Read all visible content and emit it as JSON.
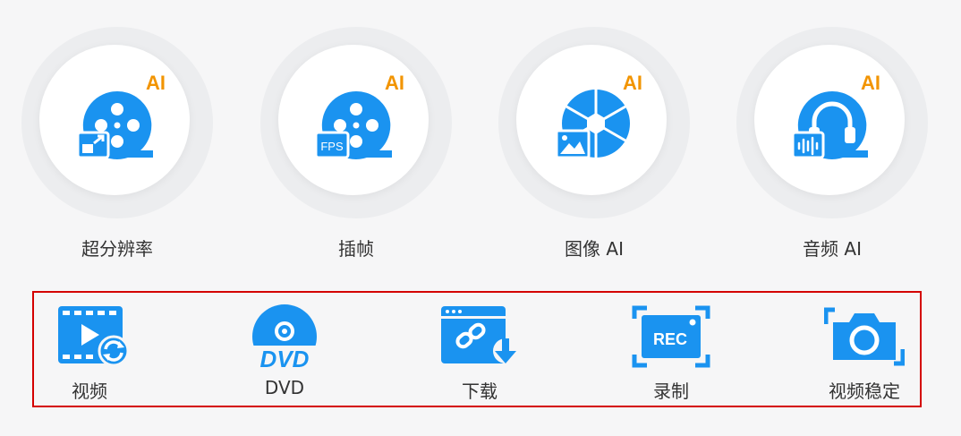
{
  "ai_tools": [
    {
      "label": "超分辨率",
      "badge": "AI",
      "icon": "film-reel-upscale-icon"
    },
    {
      "label": "插帧",
      "badge": "AI",
      "icon": "film-reel-fps-icon"
    },
    {
      "label": "图像 AI",
      "badge": "AI",
      "icon": "camera-aperture-image-icon"
    },
    {
      "label": "音频 AI",
      "badge": "AI",
      "icon": "headphones-audio-icon"
    }
  ],
  "tools": [
    {
      "label": "视频",
      "icon": "video-convert-icon"
    },
    {
      "label": "DVD",
      "icon": "dvd-disc-icon",
      "icon_text": "DVD"
    },
    {
      "label": "下载",
      "icon": "link-download-icon"
    },
    {
      "label": "录制",
      "icon": "rec-record-icon",
      "icon_text": "REC"
    },
    {
      "label": "视频稳定",
      "icon": "camera-stabilize-icon"
    }
  ],
  "colors": {
    "icon_blue": "#1a93f0",
    "ai_badge": "#f29400",
    "highlight_border": "#d40000",
    "label": "#333333"
  }
}
